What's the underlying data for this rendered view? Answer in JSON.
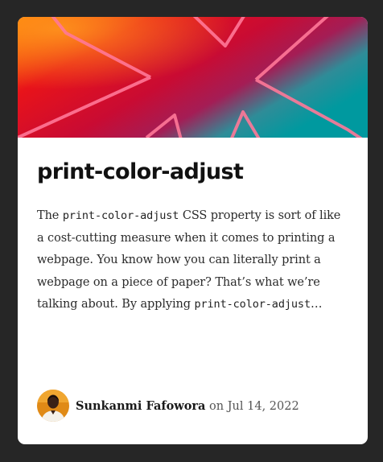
{
  "card": {
    "title": "print-color-adjust",
    "excerpt": {
      "text_1": "The ",
      "code_1": "print-color-adjust",
      "text_2": " CSS property is sort of like a cost-cutting measure when it comes to printing a webpage. You know how you can literally print a webpage on a piece of paper? That’s what we’re talking about. By applying ",
      "code_2": "print-color-adjust",
      "text_3": "…"
    },
    "author": {
      "name": "Sunkanmi Fafowora",
      "date_prefix": "on",
      "date": "Jul 14, 2022"
    }
  },
  "colors": {
    "page_background": "#262626",
    "card_background": "#ffffff",
    "hero_gradient": [
      "#ff6a00",
      "#e0161c",
      "#c40a3a",
      "#009aa0"
    ],
    "hero_star_stroke": "#ff7a9c"
  },
  "icons": {
    "hero_graphic": "star-burst-icon",
    "author_avatar": "author-photo"
  }
}
